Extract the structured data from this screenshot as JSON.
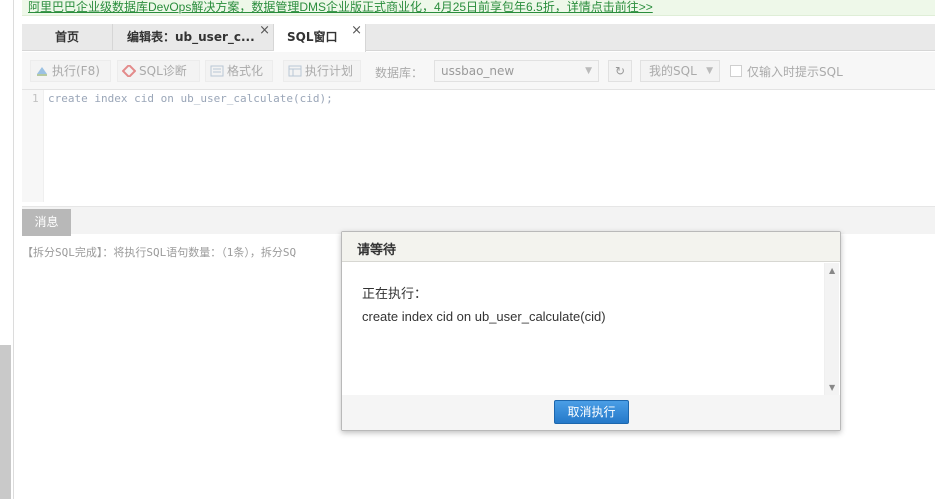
{
  "banner": {
    "text": "阿里巴巴企业级数据库DevOps解决方案，数据管理DMS企业版正式商业化，4月25日前享包年6.5折，详情点击前往>>"
  },
  "tabs": [
    {
      "label": "首页"
    },
    {
      "label": "编辑表：ub_user_c...",
      "close": "×"
    },
    {
      "label": "SQL窗口",
      "close": "×"
    }
  ],
  "toolbar": {
    "execute_label": "执行(F8)",
    "diagnose_label": "SQL诊断",
    "format_label": "格式化",
    "plan_label": "执行计划",
    "database_label": "数据库：",
    "database_value": "ussbao_new",
    "refresh_icon": "↻",
    "my_sql_label": "我的SQL",
    "hint_checkbox_label": "仅输入时提示SQL",
    "caret": "▼"
  },
  "editor": {
    "line_number": "1",
    "code": "create index cid on ub_user_calculate(cid);"
  },
  "message_panel": {
    "tab_label": "消息",
    "text": "【拆分SQL完成】：将执行SQL语句数量：（1条），拆分SQ"
  },
  "modal": {
    "title": "请等待",
    "status": "正在执行：",
    "statement": "create index cid on ub_user_calculate(cid)",
    "cancel_label": "取消执行",
    "scroll_up": "▲",
    "scroll_down": "▼"
  },
  "colors": {
    "banner_link": "#2a8d3c",
    "primary_button": "#2f88d8"
  }
}
